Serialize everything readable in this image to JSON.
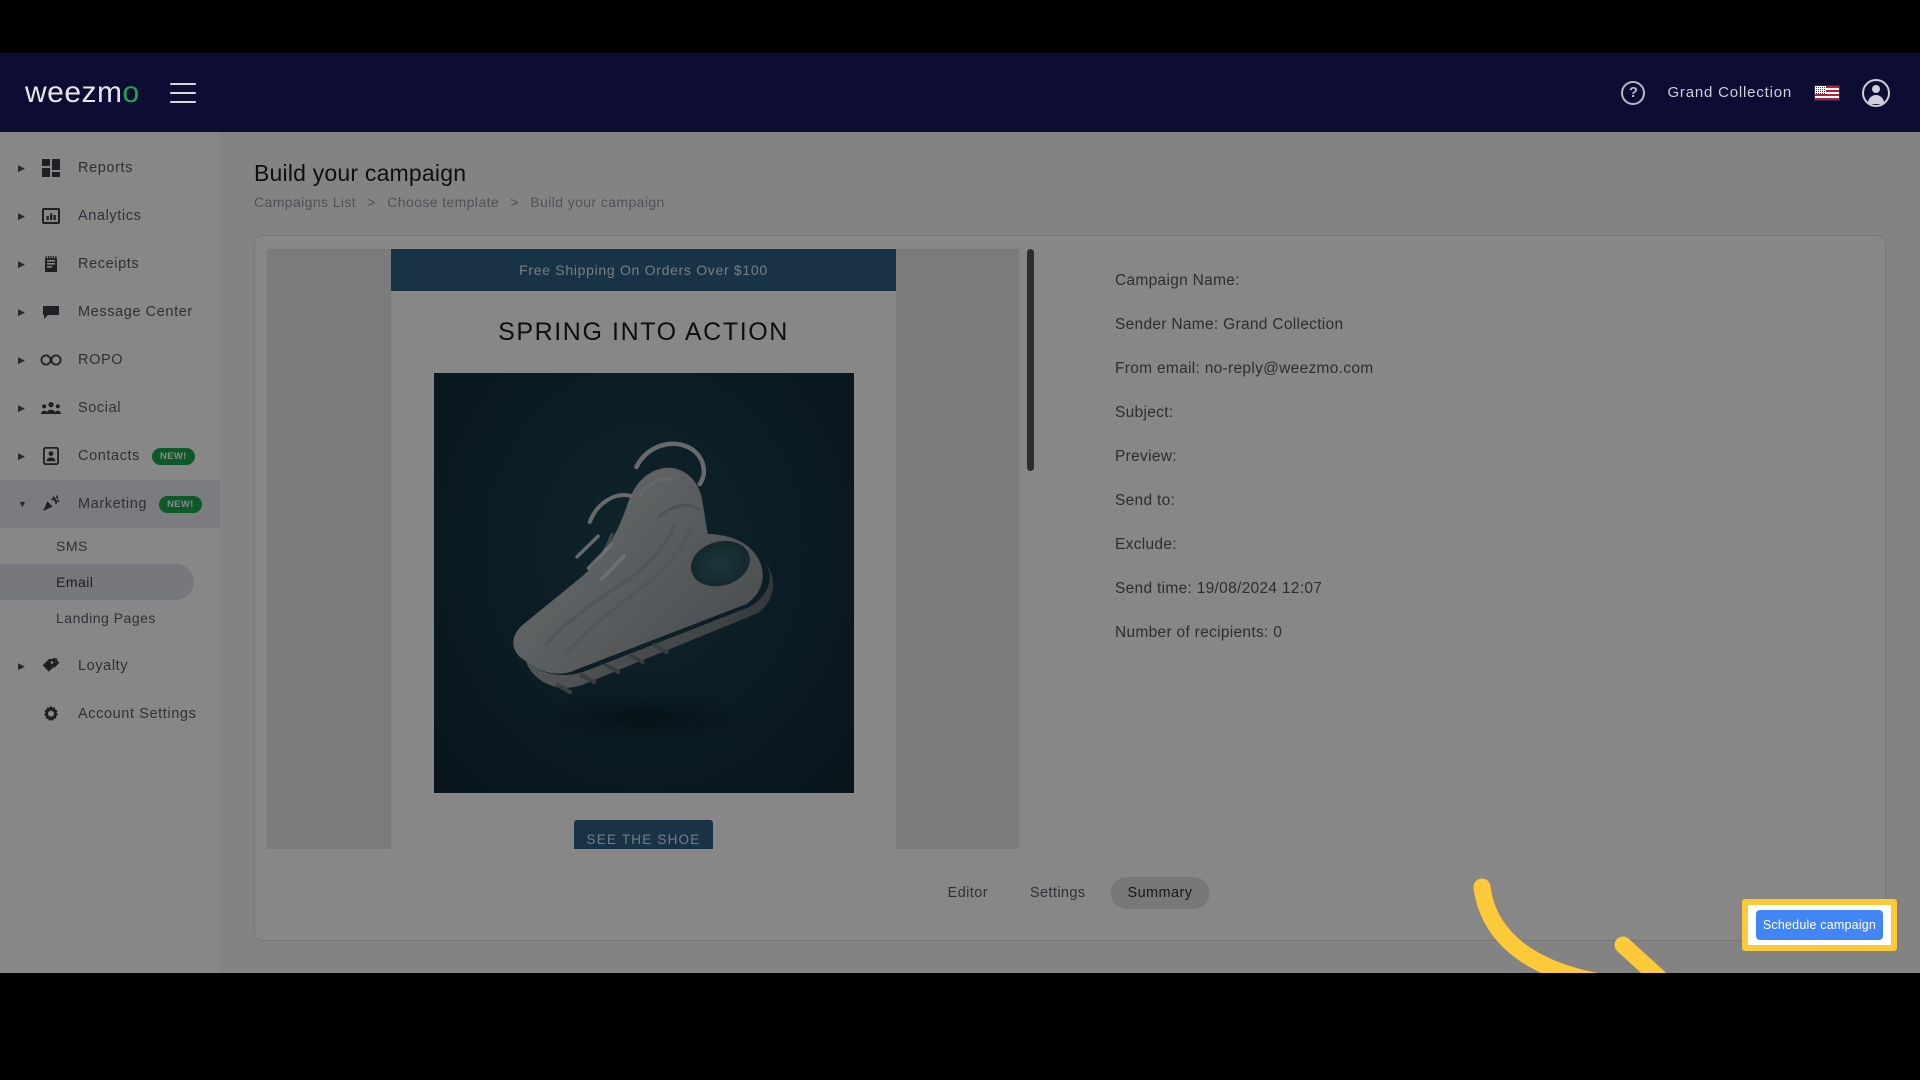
{
  "header": {
    "logo_text": "weezm",
    "logo_accent": "o",
    "menu_icon": "hamburger-icon",
    "help_icon": "?",
    "org_name": "Grand Collection",
    "flag": "us-flag",
    "avatar_icon": "account-circle-icon"
  },
  "sidebar": {
    "items": [
      {
        "label": "Reports",
        "icon": "dashboard-grid-icon",
        "expandable": true,
        "badge": null
      },
      {
        "label": "Analytics",
        "icon": "bar-chart-icon",
        "expandable": true,
        "badge": null
      },
      {
        "label": "Receipts",
        "icon": "receipt-icon",
        "expandable": true,
        "badge": null
      },
      {
        "label": "Message Center",
        "icon": "chat-bubble-icon",
        "expandable": true,
        "badge": null
      },
      {
        "label": "ROPO",
        "icon": "infinity-icon",
        "expandable": true,
        "badge": null
      },
      {
        "label": "Social",
        "icon": "people-group-icon",
        "expandable": true,
        "badge": null
      },
      {
        "label": "Contacts",
        "icon": "contact-card-icon",
        "expandable": true,
        "badge": "NEW!"
      },
      {
        "label": "Marketing",
        "icon": "megaphone-icon",
        "expandable": true,
        "badge": "NEW!"
      }
    ],
    "marketing_children": [
      {
        "label": "SMS",
        "selected": false
      },
      {
        "label": "Email",
        "selected": true
      },
      {
        "label": "Landing Pages",
        "selected": false
      }
    ],
    "tail_items": [
      {
        "label": "Loyalty",
        "icon": "tag-icon",
        "expandable": true
      },
      {
        "label": "Account Settings",
        "icon": "gear-icon",
        "expandable": false
      }
    ],
    "badge_color": "#1aa84a",
    "selected_bg": "#dfe3ef"
  },
  "main": {
    "page_title": "Build your campaign",
    "breadcrumb": [
      "Campaigns List",
      "Choose template",
      "Build your campaign"
    ],
    "breadcrumb_separator": ">"
  },
  "email_preview": {
    "promo_bar": "Free Shipping On Orders Over $100",
    "headline": "SPRING INTO ACTION",
    "cta_label": "SEE THE SHOE",
    "promo_color": "#2d6183",
    "hero_bg": "#143340",
    "hero_alt": "sneaker-product-photo"
  },
  "campaign_details": [
    "Campaign Name:",
    "Sender Name: Grand Collection",
    "From email: no-reply@weezmo.com",
    "Subject:",
    "Preview:",
    "Send to:",
    "Exclude:",
    "Send time: 19/08/2024 12:07",
    "Number of recipients: 0"
  ],
  "footer": {
    "tabs": [
      {
        "label": "Editor",
        "active": false
      },
      {
        "label": "Settings",
        "active": false
      },
      {
        "label": "Summary",
        "active": true
      }
    ],
    "schedule_label": "Schedule campaign",
    "schedule_color": "#4285f4",
    "highlight_color": "#fcc938"
  },
  "annotation": {
    "arrow": "curved-arrow-pointing-right",
    "arrow_color": "#fcc938"
  }
}
